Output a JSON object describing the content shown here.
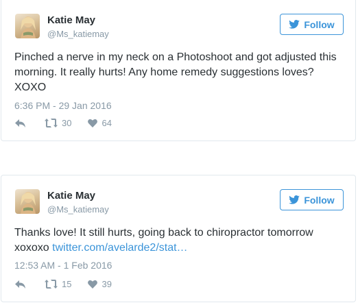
{
  "tweets": [
    {
      "name": "Katie May",
      "handle": "@Ms_katiemay",
      "follow_label": "Follow",
      "text": "Pinched a nerve in my neck on a Photoshoot and got adjusted this morning. It really hurts! Any home remedy suggestions loves? XOXO",
      "link": "",
      "timestamp": "6:36 PM - 29 Jan 2016",
      "retweets": "30",
      "likes": "64"
    },
    {
      "name": "Katie May",
      "handle": "@Ms_katiemay",
      "follow_label": "Follow",
      "text": "Thanks love! It still hurts, going back to chiropractor tomorrow xoxoxo ",
      "link": "twitter.com/avelarde2/stat…",
      "timestamp": "12:53 AM - 1 Feb 2016",
      "retweets": "15",
      "likes": "39"
    }
  ],
  "colors": {
    "accent": "#3b94d9",
    "text": "#292f33",
    "muted": "#8899a6",
    "border": "#e1e8ed"
  },
  "icons": [
    "twitter-bird-icon",
    "reply-icon",
    "retweet-icon",
    "heart-icon"
  ]
}
